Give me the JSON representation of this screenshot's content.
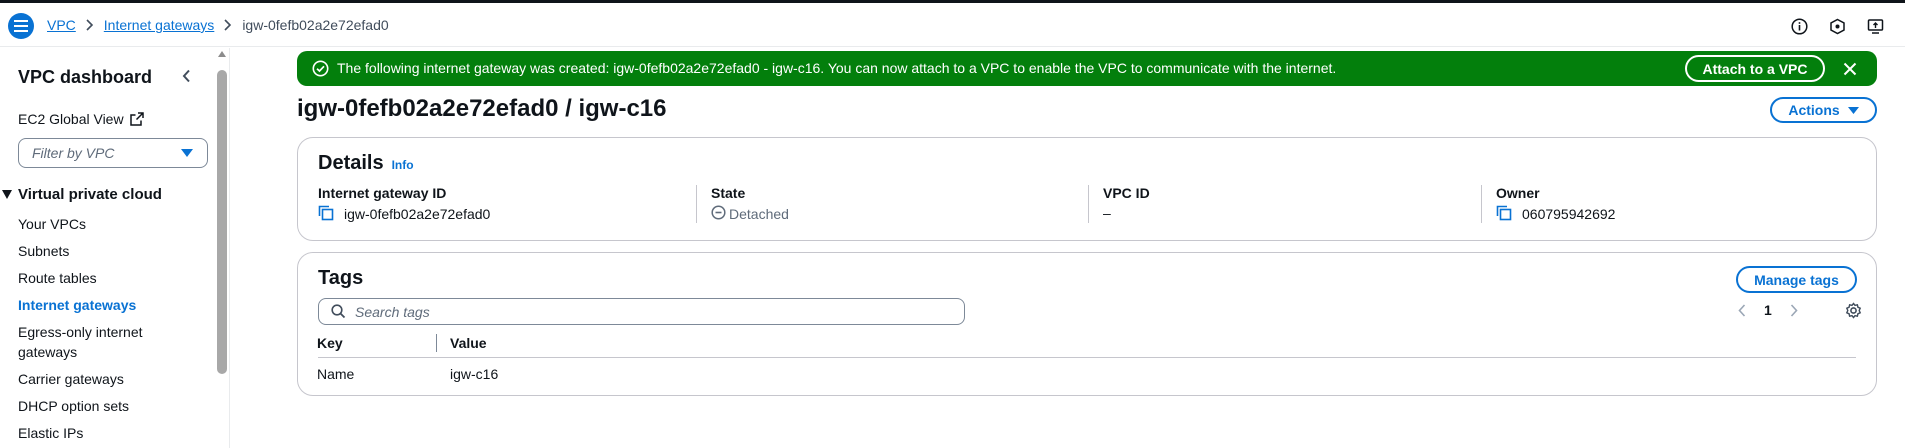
{
  "breadcrumb": {
    "items": [
      "VPC",
      "Internet gateways"
    ],
    "current": "igw-0fefb02a2e72efad0"
  },
  "sidebar": {
    "title": "VPC dashboard",
    "ec2_global_view": "EC2 Global View",
    "filter_placeholder": "Filter by VPC",
    "section": "Virtual private cloud",
    "items": [
      {
        "label": "Your VPCs"
      },
      {
        "label": "Subnets"
      },
      {
        "label": "Route tables"
      },
      {
        "label": "Internet gateways",
        "active": true
      },
      {
        "label": "Egress-only internet gateways"
      },
      {
        "label": "Carrier gateways"
      },
      {
        "label": "DHCP option sets"
      },
      {
        "label": "Elastic IPs"
      }
    ]
  },
  "flash": {
    "message": "The following internet gateway was created: igw-0fefb02a2e72efad0 - igw-c16. You can now attach to a VPC to enable the VPC to communicate with the internet.",
    "action_label": "Attach to a VPC",
    "color": "#037f0c"
  },
  "page": {
    "title": "igw-0fefb02a2e72efad0 / igw-c16",
    "actions_label": "Actions"
  },
  "details": {
    "heading": "Details",
    "info_label": "Info",
    "fields": [
      {
        "label": "Internet gateway ID",
        "value": "igw-0fefb02a2e72efad0",
        "icon": "copy-icon"
      },
      {
        "label": "State",
        "value": "Detached",
        "icon": "minus-circle-icon"
      },
      {
        "label": "VPC ID",
        "value": "–"
      },
      {
        "label": "Owner",
        "value": "060795942692",
        "icon": "copy-icon"
      }
    ]
  },
  "tags": {
    "heading": "Tags",
    "manage_label": "Manage tags",
    "search_placeholder": "Search tags",
    "page_number": "1",
    "columns": [
      "Key",
      "Value"
    ],
    "rows": [
      [
        "Name",
        "igw-c16"
      ]
    ]
  },
  "colors": {
    "accent": "#0972d3",
    "success": "#037f0c",
    "text": "#0f141a"
  }
}
